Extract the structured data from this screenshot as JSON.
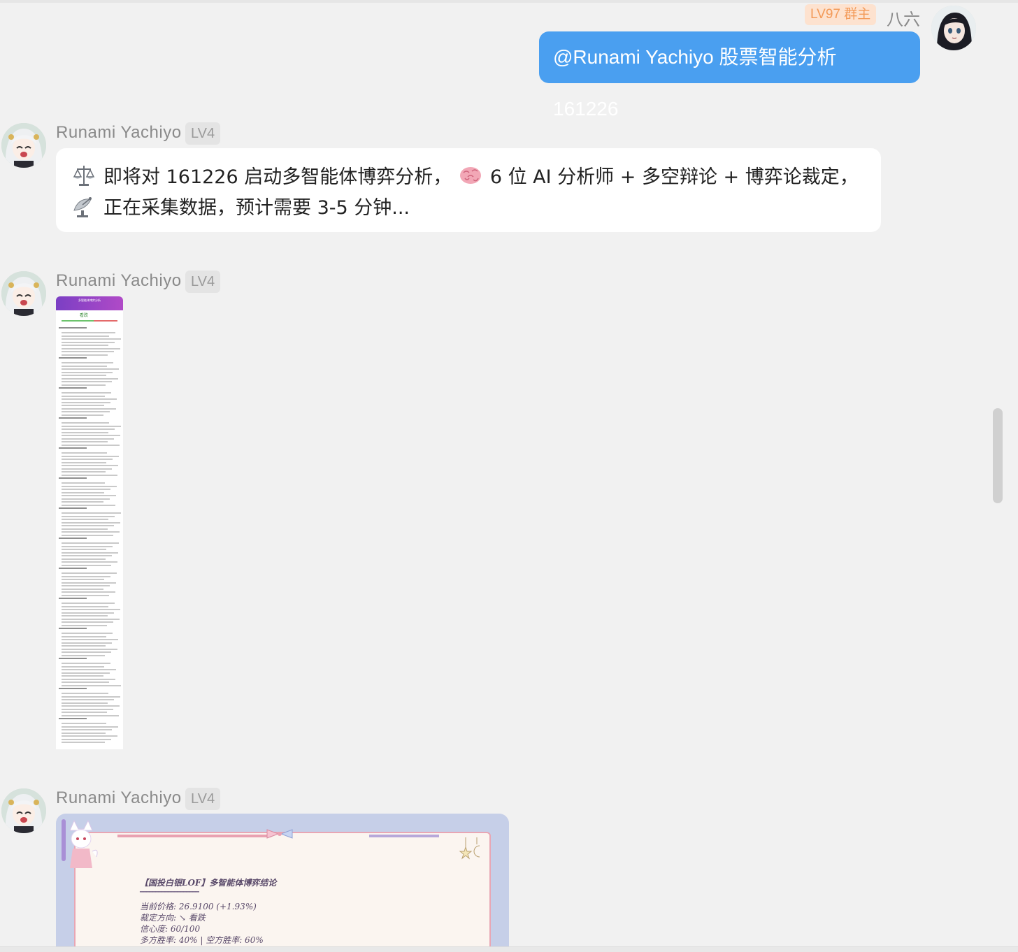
{
  "self_message": {
    "badge": "LV97 群主",
    "name": "八六",
    "text": "@Runami Yachiyo 股票智能分析 161226"
  },
  "bot": {
    "name": "Runami Yachiyo",
    "level": "LV4"
  },
  "bot_message_1": {
    "line1": "即将对 161226 启动多智能体博弈分析，",
    "line1b": "6 位 AI 分析师 + 多空辩论 + 博弈论裁定，",
    "line2": "正在采集数据，预计需要 3-5 分钟..."
  },
  "card": {
    "title": "【国投白银LOF】多智能体博弈结论",
    "divider": "━━━━━━━━━━━━━━━━━━━",
    "price": "当前价格: 26.9100 (+1.93%)",
    "direction": "裁定方向: ↘ 看跌",
    "confidence": "信心度: 60/100",
    "winrate": "多方胜率: 40% | 空方胜率: 60%"
  },
  "thumbnail": {
    "header": "多智能体博弈分析",
    "verdict": "看跌"
  },
  "icons": {
    "scale": "balance-scale-icon",
    "brain": "brain-icon",
    "satellite": "satellite-dish-icon"
  },
  "colors": {
    "blue_bubble": "#4a9ff0",
    "owner_badge_bg": "#fde2cf",
    "owner_badge_text": "#f39a58"
  }
}
